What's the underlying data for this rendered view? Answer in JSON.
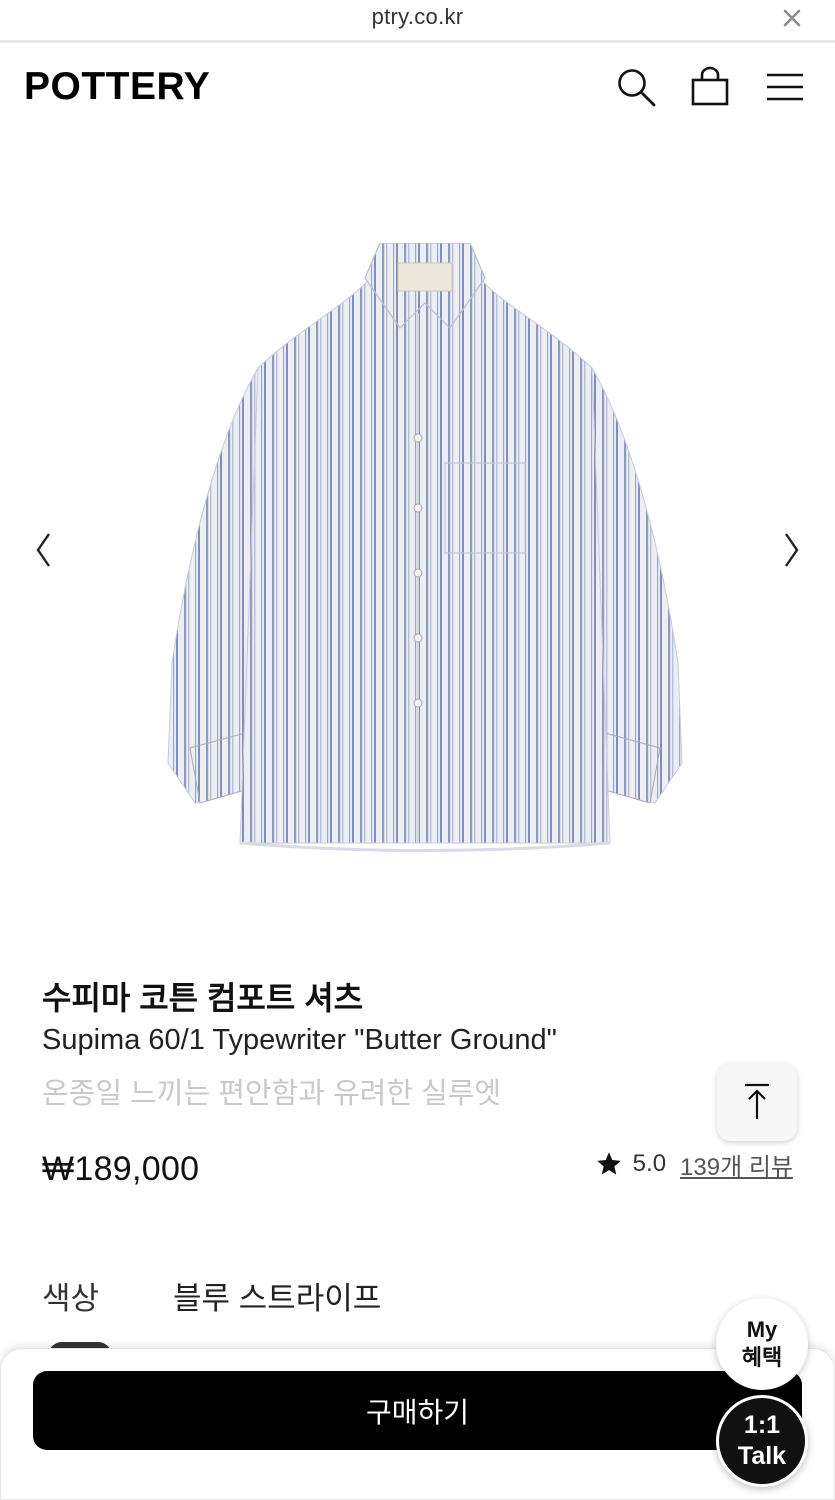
{
  "browser": {
    "url": "ptry.co.kr",
    "close_icon": "close-icon"
  },
  "header": {
    "logo": "POTTERY",
    "icons": [
      "search-icon",
      "shopping-bag-icon",
      "menu-icon"
    ]
  },
  "gallery": {
    "prev_icon": "chevron-left-icon",
    "next_icon": "chevron-right-icon",
    "image": "striped-shirt-product-image"
  },
  "product": {
    "title_ko": "수피마 코튼 컴포트 셔츠",
    "title_en": "Supima 60/1 Typewriter \"Butter Ground\"",
    "description": "온종일 느끼는 편안함과 유려한 실루엣",
    "price": "₩189,000",
    "rating": "5.0",
    "reviews": "139개 리뷰"
  },
  "option": {
    "label": "색상",
    "value": "블루 스트라이프"
  },
  "actions": {
    "buy": "구매하기",
    "my_line1": "My",
    "my_line2": "혜택",
    "talk_line1": "1:1",
    "talk_line2": "Talk",
    "scroll_top_icon": "arrow-up-to-top-icon"
  },
  "colors": {
    "accent": "#000000",
    "muted_text": "#c9c9c9",
    "stripe_blue": "#7f8fb8"
  }
}
